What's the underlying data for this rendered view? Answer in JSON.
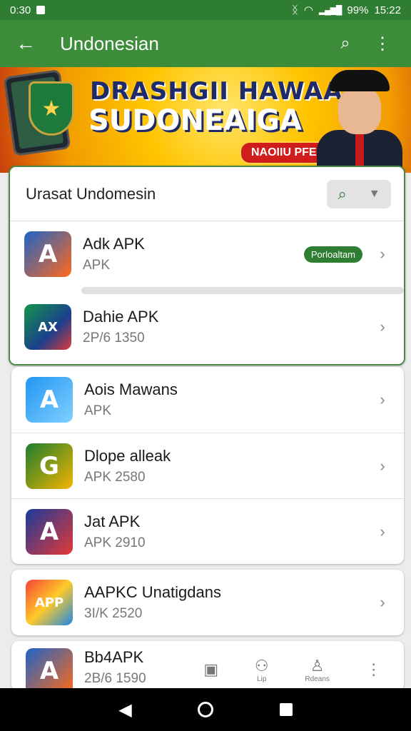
{
  "status": {
    "time_left": "0:30",
    "battery": "99%",
    "clock": "15:22"
  },
  "appbar": {
    "title": "Undonesian"
  },
  "banner": {
    "line1": "DRASHGII HAWAA",
    "line2": "SUDONEAIGA",
    "pill": "NAOIIU PFESIC"
  },
  "search": {
    "label": "Urasat Undomesin"
  },
  "apps": [
    {
      "name": "Adk APK",
      "sub": "APK",
      "badge": "Porloaltam",
      "icon_text": "A"
    },
    {
      "name": "Dahie APK",
      "sub": "2P/6 1350",
      "icon_text": "AX"
    },
    {
      "name": "Aois Mawans",
      "sub": "APK",
      "icon_text": "A"
    },
    {
      "name": "Dlope alleak",
      "sub": "APK 2580",
      "icon_text": "G"
    },
    {
      "name": "Jat APK",
      "sub": "APK 2910",
      "icon_text": "A"
    },
    {
      "name": "AAPKC Unatigdans",
      "sub": "3I/K 2520",
      "icon_text": "APP"
    },
    {
      "name": "Bb4APK",
      "sub": "2B/6 1590",
      "icon_text": "A"
    }
  ],
  "bottom_tabs": [
    {
      "icon": "bookmark-icon",
      "label": ""
    },
    {
      "icon": "group-icon",
      "label": "Lip"
    },
    {
      "icon": "user-icon",
      "label": "Rdeans"
    }
  ]
}
